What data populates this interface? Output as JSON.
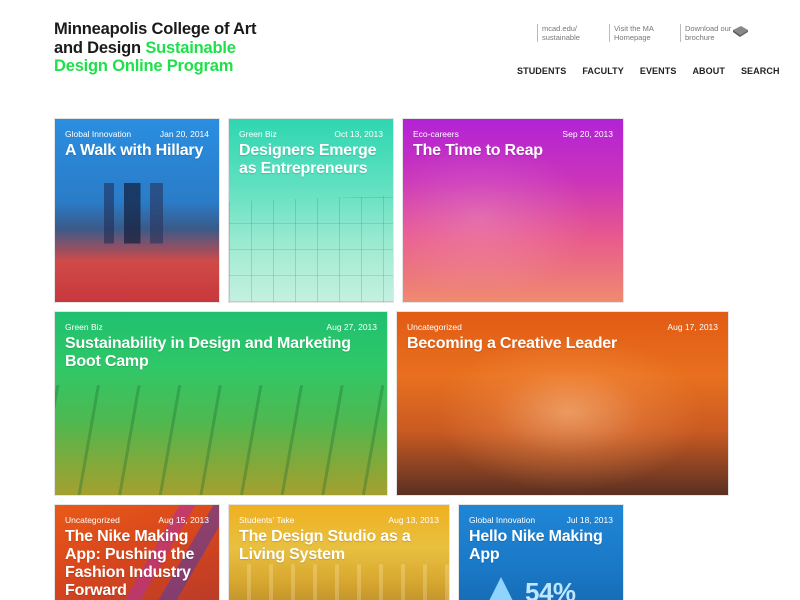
{
  "header": {
    "title_line1": "Minneapolis College of Art",
    "title_line2_dark": "and Design ",
    "title_line2_green": "Sustainable",
    "title_line3_green": "Design Online Program"
  },
  "utility_links": [
    {
      "line1": "mcad.edu/",
      "line2": "sustainable"
    },
    {
      "line1": "Visit the MA",
      "line2": "Homepage"
    },
    {
      "line1": "Download our",
      "line2": "brochure"
    }
  ],
  "nav": {
    "items": [
      "STUDENTS",
      "FACULTY",
      "EVENTS",
      "ABOUT",
      "SEARCH"
    ]
  },
  "posts": [
    {
      "category": "Global Innovation",
      "date": "Jan 20, 2014",
      "title": "A Walk with Hillary"
    },
    {
      "category": "Green Biz",
      "date": "Oct 13, 2013",
      "title": "Designers Emerge as Entrepreneurs"
    },
    {
      "category": "Eco-careers",
      "date": "Sep 20, 2013",
      "title": "The Time to Reap"
    },
    {
      "category": "Green Biz",
      "date": "Aug 27, 2013",
      "title": "Sustainability in Design and Marketing Boot Camp"
    },
    {
      "category": "Uncategorized",
      "date": "Aug 17, 2013",
      "title": "Becoming a Creative Leader"
    },
    {
      "category": "Uncategorized",
      "date": "Aug 15, 2013",
      "title": "The Nike Making App: Pushing the Fashion Industry Forward"
    },
    {
      "category": "Students' Take",
      "date": "Aug 13, 2013",
      "title": "The Design Studio as a Living System"
    },
    {
      "category": "Global Innovation",
      "date": "Jul 18, 2013",
      "title": "Hello Nike Making App"
    }
  ],
  "tile7_figure": "54%",
  "colors": {
    "brand_green": "#1fe04a",
    "tile_blue": "#1f86d6",
    "tile_teal": "#35d6a8",
    "tile_magenta": "#c42ad0",
    "tile_green": "#2bc85f",
    "tile_orange": "#e6631a"
  },
  "icons": [
    "brochure-icon"
  ]
}
